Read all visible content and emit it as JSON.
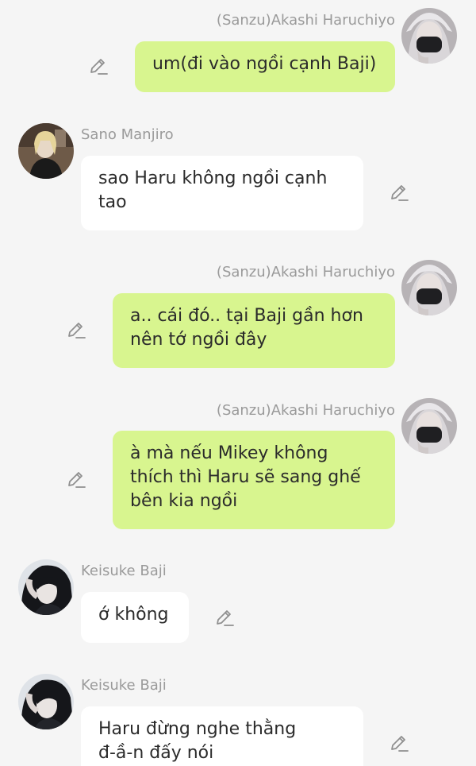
{
  "chat": {
    "messages": [
      {
        "sender": "(Sanzu)Akashi Haruchiyo",
        "side": "right",
        "text": "um(đi vào ngồi cạnh Baji)",
        "avatar_icon": "masked-person-avatar"
      },
      {
        "sender": "Sano Manjiro",
        "side": "left",
        "text": "sao Haru không ngồi cạnh\ntao",
        "avatar_icon": "blond-person-avatar"
      },
      {
        "sender": "(Sanzu)Akashi Haruchiyo",
        "side": "right",
        "text": "a.. cái đó.. tại Baji gần hơn\nnên tớ ngồi đây",
        "avatar_icon": "masked-person-avatar"
      },
      {
        "sender": "(Sanzu)Akashi Haruchiyo",
        "side": "right",
        "text": "à mà nếu Mikey không\nthích thì Haru sẽ sang ghế\nbên kia ngồi",
        "avatar_icon": "masked-person-avatar"
      },
      {
        "sender": "Keisuke Baji",
        "side": "left",
        "text": "ớ không",
        "avatar_icon": "dark-hair-person-avatar"
      },
      {
        "sender": "Keisuke Baji",
        "side": "left",
        "text": "Haru đừng nghe thằng\nđ-ầ-n đấy nói",
        "avatar_icon": "dark-hair-person-avatar"
      }
    ],
    "edit_icon": "pencil-icon",
    "colors": {
      "background": "#f5f5f5",
      "my_bubble": "#d8f58f",
      "their_bubble": "#ffffff",
      "name_text": "#9a9a9a",
      "message_text": "#2b2b2b"
    }
  }
}
